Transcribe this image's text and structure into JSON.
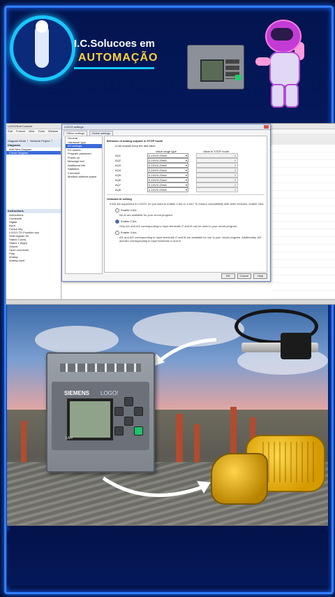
{
  "header": {
    "brand_line1": "I.C.Solucoes em",
    "brand_line2": "AUTOMAÇÃO"
  },
  "window": {
    "title": "LOGO!Soft Comfort",
    "menu": [
      "Edit",
      "Format",
      "View",
      "Tools",
      "Window",
      "Help"
    ],
    "left_tabs": [
      "Diagram Mode",
      "Network Project"
    ],
    "diagrams_header": "Diagrams",
    "diagram_items": [
      "Add New Diagram",
      "Circuit Diagram"
    ],
    "instructions_header": "Instructions",
    "instruction_items": [
      "Instructions",
      "Constants",
      "Digital",
      "Input",
      "Cursor key",
      "LOGO! TD Function key",
      "Shift register bit",
      "Status 0 (low)",
      "Status 1 (high)",
      "Output",
      "Open connector",
      "Flag",
      "Analog",
      "Analog input"
    ]
  },
  "dialog": {
    "title": "LOGO! settings",
    "tabs": [
      "Offline settings",
      "Online settings"
    ],
    "nav": [
      "General",
      "Hardware type",
      "I/O settings",
      "I/O names",
      "Program password",
      "Power-on",
      "Message text",
      "Additional info",
      "Statistics",
      "Comment",
      "Modbus address space"
    ],
    "section1_title": "Behavior of analog outputs in STOP mode",
    "checkbox_label": "All outputs keep the last value",
    "col_range": "Value range type",
    "col_value": "Value in STOP mode",
    "outputs": [
      {
        "name": "AQ1",
        "range": "0-10V/0-20mA",
        "value": "0"
      },
      {
        "name": "AQ2",
        "range": "0-10V/0-20mA",
        "value": "0"
      },
      {
        "name": "AQ3",
        "range": "0-10V/0-20mA",
        "value": "0"
      },
      {
        "name": "AQ4",
        "range": "0-10V/0-20mA",
        "value": "0"
      },
      {
        "name": "AQ5",
        "range": "0-10V/0-20mA",
        "value": "0"
      },
      {
        "name": "AQ6",
        "range": "0-10V/0-20mA",
        "value": "0"
      },
      {
        "name": "AQ7",
        "range": "0-10V/0-20mA",
        "value": "0"
      },
      {
        "name": "AQ8",
        "range": "0-10V/0-20mA",
        "value": "0"
      }
    ],
    "section2_title": "Onboard AI setting",
    "section2_desc": "If AI4 are supported in LOGO!, do you want to enable 2 AIs or 4 AIs? To ensure compatibility with older versions, enable 2AIs.",
    "radio0": "Enable 0 AIs",
    "radio0_sub": "No AI are available for your circuit program.",
    "radio2": "Enable 2 AIs",
    "radio2_sub": "Only AI1 and AI2 corresponding to input terminals I7 and I8 can be used in your circuit program.",
    "radio4": "Enable 4 AIs",
    "radio4_sub": "AI1 and AI2 corresponding to input terminals I7 and I8 are available for use in your circuit program. Additionally, AI3 and AI4 corresponding to input terminals I1 and I2",
    "buttons": [
      "OK",
      "Cancel",
      "Help"
    ]
  },
  "plc": {
    "brand": "SIEMENS",
    "model": "LOGO!",
    "port": "LAN"
  },
  "colors": {
    "frame": "#2f7fff",
    "accent_yellow": "#ffd23f",
    "logo_cyan": "#19c6ff"
  }
}
